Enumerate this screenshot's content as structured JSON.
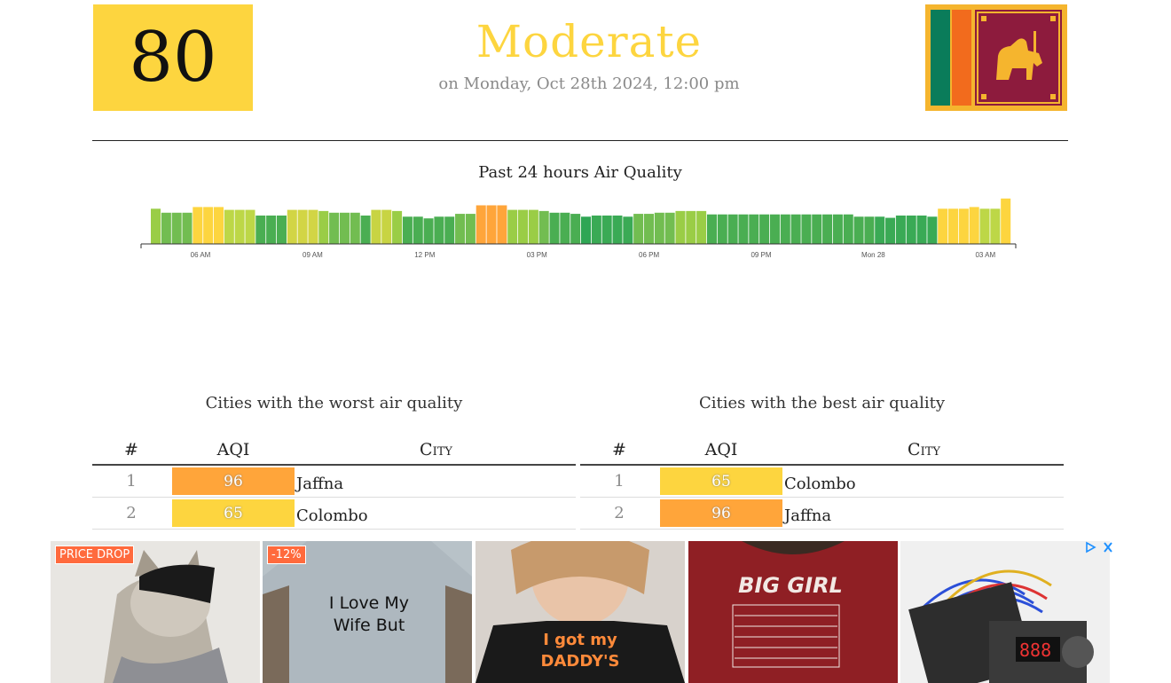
{
  "summary": {
    "aqi": "80",
    "status": "Moderate",
    "timestamp": "on Monday, Oct 28th 2024, 12:00 pm",
    "colors": {
      "moderate": "#fdd53f",
      "good": "#5bb85c",
      "sensitive": "#ffa53a"
    }
  },
  "flag": {
    "icon": "sri-lanka-flag-icon"
  },
  "chart_data": {
    "type": "bar",
    "title": "Past 24 hours Air Quality",
    "x_ticks": [
      "06 AM",
      "09 AM",
      "12 PM",
      "03 PM",
      "06 PM",
      "09 PM",
      "Mon 28",
      "03 AM"
    ],
    "values": [
      62,
      55,
      55,
      55,
      65,
      65,
      65,
      60,
      60,
      60,
      50,
      50,
      50,
      60,
      60,
      60,
      58,
      55,
      55,
      55,
      50,
      60,
      60,
      58,
      48,
      48,
      45,
      48,
      48,
      53,
      53,
      68,
      68,
      68,
      60,
      60,
      60,
      58,
      55,
      55,
      53,
      48,
      50,
      50,
      50,
      48,
      53,
      53,
      55,
      55,
      58,
      58,
      58,
      52,
      52,
      52,
      52,
      52,
      52,
      52,
      52,
      52,
      52,
      52,
      52,
      52,
      52,
      48,
      48,
      48,
      46,
      50,
      50,
      50,
      48,
      62,
      62,
      62,
      65,
      62,
      62,
      80
    ],
    "colors": [
      "#9acd46",
      "#72bd51",
      "#72bd51",
      "#72bd51",
      "#fdd53f",
      "#fdd53f",
      "#fdd53f",
      "#bdd747",
      "#bdd747",
      "#bdd747",
      "#4aae52",
      "#4aae52",
      "#4aae52",
      "#d2d545",
      "#d2d545",
      "#d2d545",
      "#9acd46",
      "#72bd51",
      "#72bd51",
      "#72bd51",
      "#4aae52",
      "#c8d443",
      "#c8d443",
      "#9acd46",
      "#4aae52",
      "#4aae52",
      "#4aae52",
      "#4aae52",
      "#4aae52",
      "#72bd51",
      "#72bd51",
      "#ffa53a",
      "#ffa53a",
      "#ffa53a",
      "#9acd46",
      "#9acd46",
      "#9acd46",
      "#72bd51",
      "#4aae52",
      "#4aae52",
      "#4aae52",
      "#2fa654",
      "#3aaa55",
      "#3aaa55",
      "#3aaa55",
      "#3aaa55",
      "#72bd51",
      "#72bd51",
      "#72bd51",
      "#72bd51",
      "#9acd46",
      "#9acd46",
      "#9acd46",
      "#4aae52",
      "#4aae52",
      "#4aae52",
      "#4aae52",
      "#4aae52",
      "#4aae52",
      "#4aae52",
      "#4aae52",
      "#4aae52",
      "#4aae52",
      "#4aae52",
      "#4aae52",
      "#4aae52",
      "#4aae52",
      "#4aae52",
      "#4aae52",
      "#3aaa55",
      "#3aaa55",
      "#3aaa55",
      "#3aaa55",
      "#3aaa55",
      "#3aaa55",
      "#fdd53f",
      "#fdd53f",
      "#fdd53f",
      "#fdd53f",
      "#bdd747",
      "#bdd747",
      "#fdd53f"
    ],
    "ylim": [
      0,
      100
    ],
    "grid": false,
    "legend": "none"
  },
  "worst": {
    "title": "Cities with the worst air quality",
    "headers": {
      "num": "#",
      "aqi": "AQI",
      "city": "City"
    },
    "rows": [
      {
        "num": "1",
        "aqi": "96",
        "color": "#ffa53a",
        "city": "Jaffna"
      },
      {
        "num": "2",
        "aqi": "65",
        "color": "#fdd53f",
        "city": "Colombo"
      }
    ]
  },
  "best": {
    "title": "Cities with the best air quality",
    "headers": {
      "num": "#",
      "aqi": "AQI",
      "city": "City"
    },
    "rows": [
      {
        "num": "1",
        "aqi": "65",
        "color": "#fdd53f",
        "city": "Colombo"
      },
      {
        "num": "2",
        "aqi": "96",
        "color": "#ffa53a",
        "city": "Jaffna"
      }
    ]
  },
  "ads": {
    "items": [
      {
        "badge": "PRICE DROP",
        "icon": "cat-shirt-product-image",
        "bg": "#e8e6e2"
      },
      {
        "badge": "-12%",
        "icon": "tshirt-product-image",
        "bg": "#b8c2c8",
        "text": "I Love My Wife But"
      },
      {
        "badge": "",
        "icon": "kid-tshirt-product-image",
        "bg": "#d8d2cc",
        "text": "I got my DADDY'S"
      },
      {
        "badge": "",
        "icon": "big-girl-tshirt-product-image",
        "bg": "#8f1f24",
        "text": "BIG GIRL"
      },
      {
        "badge": "",
        "icon": "motor-controller-product-image",
        "bg": "#f0f0f0"
      }
    ],
    "choices_icon": "ad-choices-icon"
  }
}
